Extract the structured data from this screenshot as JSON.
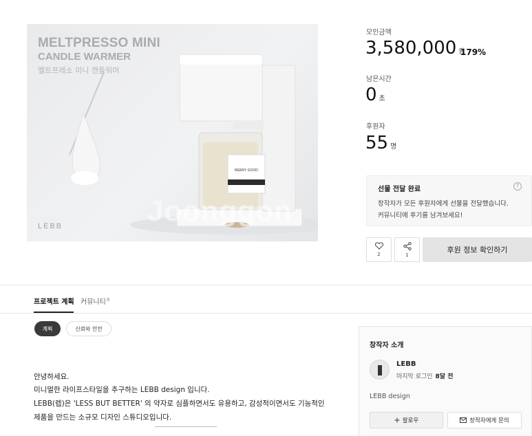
{
  "hero": {
    "title_line1": "MELTPRESSO MINI",
    "title_line2": "CANDLE WARMER",
    "title_line3": "멜트프레소 미니 캔들워머",
    "brand": "LEBB",
    "watermark": "Joonggon",
    "jar_label": "BERRY GOOD"
  },
  "funding": {
    "amount_label": "모인금액",
    "amount": "3,580,000",
    "amount_unit": "원",
    "percent": "179%",
    "time_label": "남은시간",
    "time": "0",
    "time_unit": "초",
    "backers_label": "후원자",
    "backers": "55",
    "backers_unit": "명"
  },
  "notice": {
    "title": "선물 전달 완료",
    "line1": "창작자가 모든 후원자에게 선물을 전달했습니다.",
    "line2": "커뮤니티에 후기를 남겨보세요!",
    "help": "?"
  },
  "actions": {
    "like_count": "2",
    "share_count": "1",
    "primary": "후원 정보 확인하기"
  },
  "tabs": {
    "active": "프로젝트 계획",
    "community": "커뮤니티",
    "community_count": "8"
  },
  "pills": {
    "plan": "계획",
    "trust": "신뢰와 안전"
  },
  "body": {
    "line1": "안녕하세요.",
    "line2": "미니멀한 라이프스타일을 추구하는 LEBB design 입니다.",
    "line3": "LEBB(렙)은 'LESS BUT BETTER' 의 약자로 심플하면서도 유용하고, 감성적이면서도 기능적인",
    "line4": "제품을 만드는 소규모 디자인 스튜디오입니다."
  },
  "creator": {
    "heading": "창작자 소개",
    "name": "LEBB",
    "last_login_label": "마지막 로그인",
    "last_login_value": "8달 전",
    "description": "LEBB design",
    "follow": "팔로우",
    "ask": "창작자에게 문의"
  },
  "colors": {
    "accent_dark": "#3a3a3a",
    "button_gray": "#e4e4e4"
  }
}
